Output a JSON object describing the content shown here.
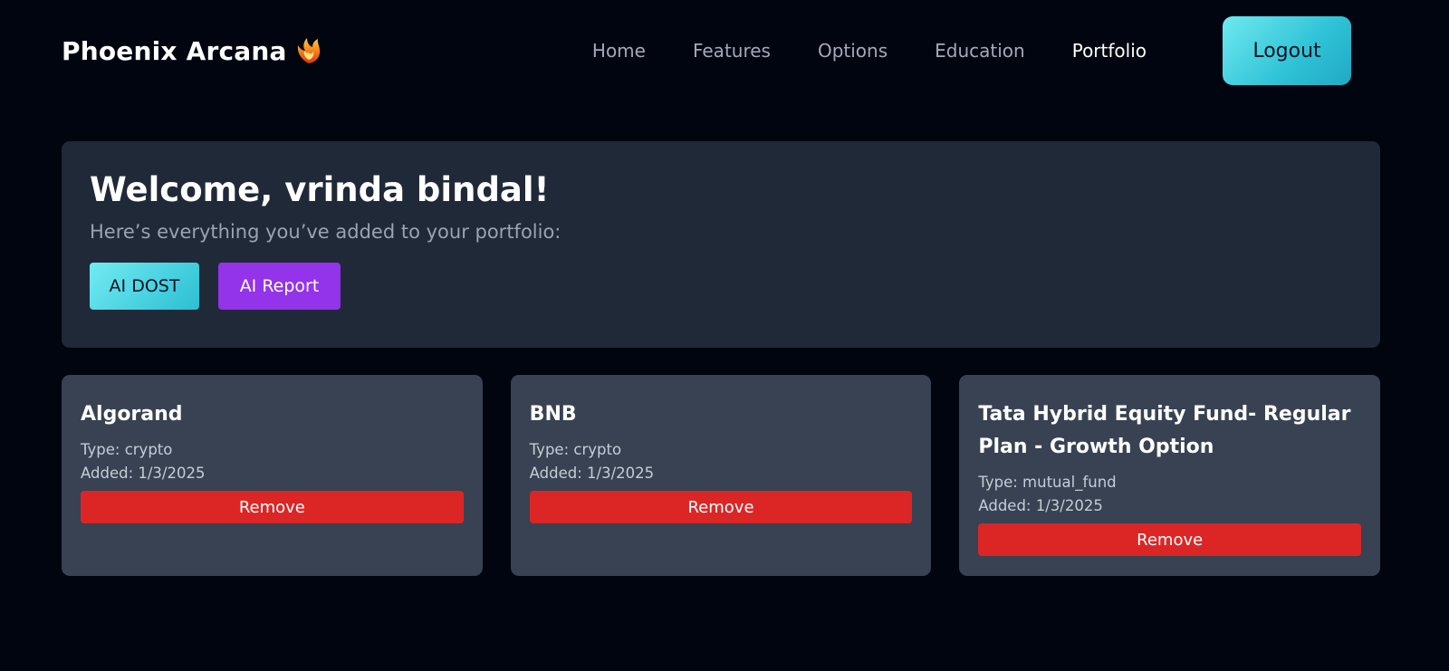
{
  "brand": {
    "name": "Phoenix Arcana",
    "logo_icon": "phoenix-icon"
  },
  "nav": {
    "links": [
      {
        "label": "Home",
        "active": false
      },
      {
        "label": "Features",
        "active": false
      },
      {
        "label": "Options",
        "active": false
      },
      {
        "label": "Education",
        "active": false
      },
      {
        "label": "Portfolio",
        "active": true
      }
    ],
    "logout_label": "Logout"
  },
  "welcome": {
    "title": "Welcome, vrinda bindal!",
    "subtitle": "Here’s everything you’ve added to your portfolio:",
    "ai_dost_label": "AI DOST",
    "ai_report_label": "AI Report"
  },
  "portfolio": {
    "items": [
      {
        "name": "Algorand",
        "type_text": "Type: crypto",
        "added_text": "Added: 1/3/2025",
        "remove_label": "Remove"
      },
      {
        "name": "BNB",
        "type_text": "Type: crypto",
        "added_text": "Added: 1/3/2025",
        "remove_label": "Remove"
      },
      {
        "name": "Tata Hybrid Equity Fund- Regular Plan - Growth Option",
        "type_text": "Type: mutual_fund",
        "added_text": "Added: 1/3/2025",
        "remove_label": "Remove"
      }
    ]
  },
  "colors": {
    "background": "#010510",
    "panel": "#202938",
    "card": "#384253",
    "accent_cyan": "#2fc2d6",
    "accent_purple": "#9333ea",
    "danger": "#dc2626"
  }
}
